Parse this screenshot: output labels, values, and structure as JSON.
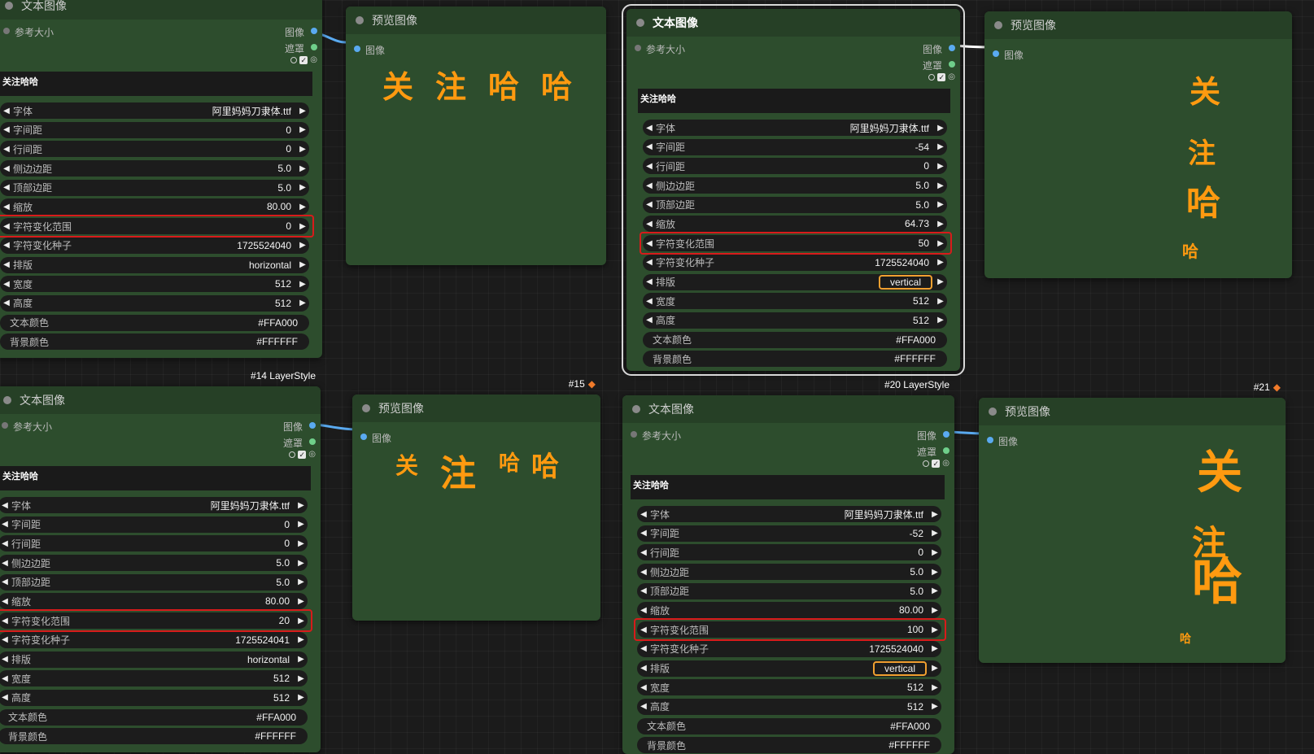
{
  "text_nodes": [
    {
      "title": "文本图像",
      "badge": "",
      "ref_label": "参考大小",
      "out_image": "图像",
      "out_mask": "遮罩",
      "text": "关注哈哈",
      "widgets": [
        {
          "label": "字体",
          "value": "阿里妈妈刀隶体.ttf"
        },
        {
          "label": "字间距",
          "value": "0"
        },
        {
          "label": "行间距",
          "value": "0"
        },
        {
          "label": "侧边边距",
          "value": "5.0"
        },
        {
          "label": "顶部边距",
          "value": "5.0"
        },
        {
          "label": "缩放",
          "value": "80.00"
        },
        {
          "label": "字符变化范围",
          "value": "0"
        },
        {
          "label": "字符变化种子",
          "value": "1725524040"
        },
        {
          "label": "排版",
          "value": "horizontal"
        },
        {
          "label": "宽度",
          "value": "512"
        },
        {
          "label": "高度",
          "value": "512"
        },
        {
          "label": "文本颜色",
          "value": "#FFA000"
        },
        {
          "label": "背景颜色",
          "value": "#FFFFFF"
        }
      ]
    },
    {
      "title": "文本图像",
      "badge": "",
      "ref_label": "参考大小",
      "out_image": "图像",
      "out_mask": "遮罩",
      "text": "关注哈哈",
      "widgets": [
        {
          "label": "字体",
          "value": "阿里妈妈刀隶体.ttf"
        },
        {
          "label": "字间距",
          "value": "-54"
        },
        {
          "label": "行间距",
          "value": "0"
        },
        {
          "label": "侧边边距",
          "value": "5.0"
        },
        {
          "label": "顶部边距",
          "value": "5.0"
        },
        {
          "label": "缩放",
          "value": "64.73"
        },
        {
          "label": "字符变化范围",
          "value": "50"
        },
        {
          "label": "字符变化种子",
          "value": "1725524040"
        },
        {
          "label": "排版",
          "value": "vertical"
        },
        {
          "label": "宽度",
          "value": "512"
        },
        {
          "label": "高度",
          "value": "512"
        },
        {
          "label": "文本颜色",
          "value": "#FFA000"
        },
        {
          "label": "背景颜色",
          "value": "#FFFFFF"
        }
      ]
    },
    {
      "title": "文本图像",
      "badge": "#14 LayerStyle",
      "ref_label": "参考大小",
      "out_image": "图像",
      "out_mask": "遮罩",
      "text": "关注哈哈",
      "widgets": [
        {
          "label": "字体",
          "value": "阿里妈妈刀隶体.ttf"
        },
        {
          "label": "字间距",
          "value": "0"
        },
        {
          "label": "行间距",
          "value": "0"
        },
        {
          "label": "侧边边距",
          "value": "5.0"
        },
        {
          "label": "顶部边距",
          "value": "5.0"
        },
        {
          "label": "缩放",
          "value": "80.00"
        },
        {
          "label": "字符变化范围",
          "value": "20"
        },
        {
          "label": "字符变化种子",
          "value": "1725524041"
        },
        {
          "label": "排版",
          "value": "horizontal"
        },
        {
          "label": "宽度",
          "value": "512"
        },
        {
          "label": "高度",
          "value": "512"
        },
        {
          "label": "文本颜色",
          "value": "#FFA000"
        },
        {
          "label": "背景颜色",
          "value": "#FFFFFF"
        }
      ]
    },
    {
      "title": "文本图像",
      "badge": "#20 LayerStyle",
      "ref_label": "参考大小",
      "out_image": "图像",
      "out_mask": "遮罩",
      "text": "关注哈哈",
      "widgets": [
        {
          "label": "字体",
          "value": "阿里妈妈刀隶体.ttf"
        },
        {
          "label": "字间距",
          "value": "-52"
        },
        {
          "label": "行间距",
          "value": "0"
        },
        {
          "label": "侧边边距",
          "value": "5.0"
        },
        {
          "label": "顶部边距",
          "value": "5.0"
        },
        {
          "label": "缩放",
          "value": "80.00"
        },
        {
          "label": "字符变化范围",
          "value": "100"
        },
        {
          "label": "字符变化种子",
          "value": "1725524040"
        },
        {
          "label": "排版",
          "value": "vertical"
        },
        {
          "label": "宽度",
          "value": "512"
        },
        {
          "label": "高度",
          "value": "512"
        },
        {
          "label": "文本颜色",
          "value": "#FFA000"
        },
        {
          "label": "背景颜色",
          "value": "#FFFFFF"
        }
      ]
    }
  ],
  "preview_nodes": [
    {
      "title": "预览图像",
      "badge": "",
      "in_label": "图像",
      "chars": [
        "关",
        "注",
        "哈",
        "哈"
      ]
    },
    {
      "title": "预览图像",
      "badge": "",
      "in_label": "图像",
      "chars": [
        "关",
        "注",
        "哈",
        "哈"
      ]
    },
    {
      "title": "预览图像",
      "badge": "#15",
      "in_label": "图像",
      "chars": [
        "关",
        "注",
        "哈",
        "哈"
      ]
    },
    {
      "title": "预览图像",
      "badge": "#21",
      "in_label": "图像",
      "chars": [
        "关",
        "注",
        "哈",
        "哈"
      ]
    }
  ],
  "colors": {
    "node_body": "#2d4d2d",
    "node_header": "#264026",
    "preview_text": "#ff9a10",
    "highlight_red": "#d81b1b",
    "highlight_orange": "#f0a030",
    "wire": "#5aaaf0"
  }
}
